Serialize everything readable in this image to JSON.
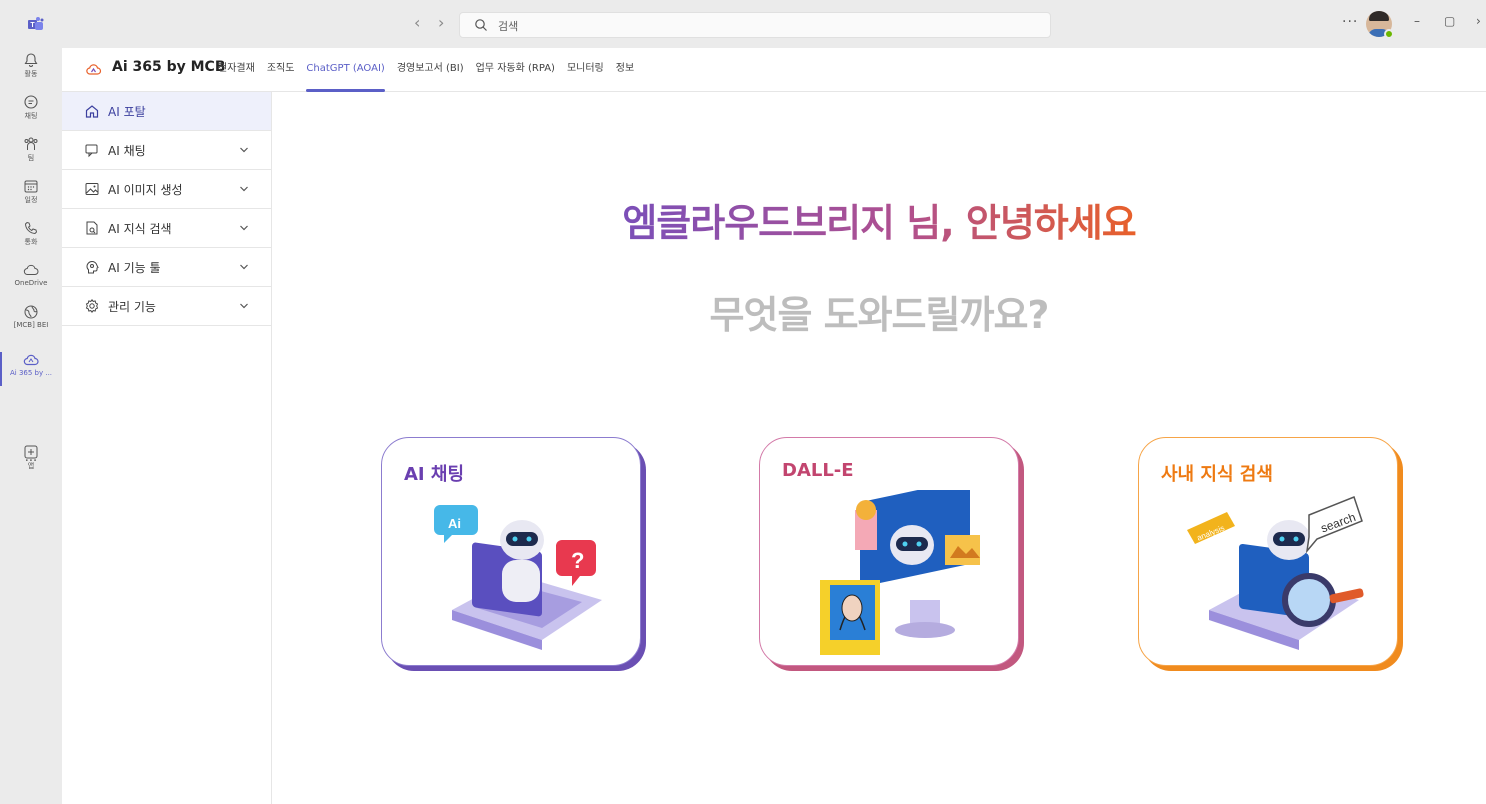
{
  "titlebar": {
    "search_placeholder": "검색",
    "more": "···",
    "minimize": "–",
    "maximize": "▢",
    "close": "›"
  },
  "rail": {
    "items": [
      {
        "label": "활동",
        "icon": "bell-icon"
      },
      {
        "label": "채팅",
        "icon": "chat-icon"
      },
      {
        "label": "팀",
        "icon": "teams-icon"
      },
      {
        "label": "일정",
        "icon": "calendar-icon"
      },
      {
        "label": "통화",
        "icon": "phone-icon"
      },
      {
        "label": "OneDrive",
        "icon": "cloud-icon"
      },
      {
        "label": "[MCB] BEI",
        "icon": "globe-icon"
      },
      {
        "label": "Ai 365 by ...",
        "icon": "cloud-app-icon"
      },
      {
        "label": "앱",
        "icon": "add-app-icon"
      }
    ],
    "more": "···"
  },
  "app": {
    "name": "Ai 365 by MCB",
    "tabs": [
      "전자결재",
      "조직도",
      "ChatGPT (AOAI)",
      "경영보고서 (BI)",
      "업무 자동화 (RPA)",
      "모니터링",
      "정보"
    ],
    "active_tab": "ChatGPT (AOAI)"
  },
  "sidenav": {
    "items": [
      {
        "label": "AI 포탈",
        "icon": "home-icon",
        "active": true
      },
      {
        "label": "AI 채팅",
        "icon": "chat-bubble-icon"
      },
      {
        "label": "AI 이미지 생성",
        "icon": "image-icon"
      },
      {
        "label": "AI 지식 검색",
        "icon": "doc-search-icon"
      },
      {
        "label": "AI 기능 툴",
        "icon": "brain-icon"
      },
      {
        "label": "관리 기능",
        "icon": "gear-icon"
      }
    ]
  },
  "main": {
    "greeting": "엠클라우드브리지 님, 안녕하세요",
    "subgreeting": "무엇을 도와드릴까요?",
    "cards": [
      {
        "title": "AI 채팅"
      },
      {
        "title": "DALL-E"
      },
      {
        "title": "사내 지식 검색"
      }
    ]
  },
  "colors": {
    "accent": "#5b5fc7",
    "chat_card": "#6a4fb3",
    "dalle_card": "#c2587f",
    "search_card": "#f08b1e"
  }
}
